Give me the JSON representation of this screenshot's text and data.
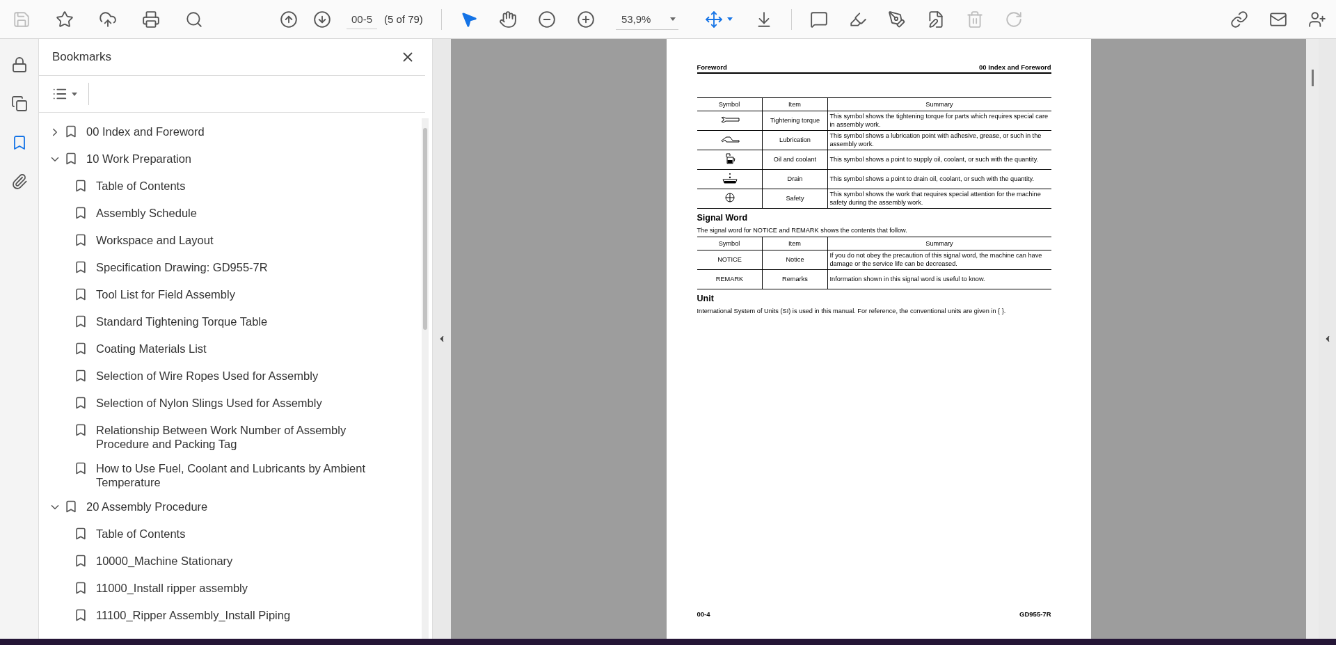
{
  "toolbar": {
    "file_tools": [
      {
        "kind": "save",
        "disabled": true
      },
      {
        "kind": "star",
        "disabled": false
      },
      {
        "kind": "upload",
        "disabled": false
      },
      {
        "kind": "print",
        "disabled": false
      },
      {
        "kind": "find",
        "disabled": false
      }
    ],
    "navigation": {
      "page_field": "00-5",
      "page_count": "(5 of 79)"
    },
    "view_tools": [
      {
        "kind": "pointer",
        "selected": true
      },
      {
        "kind": "hand",
        "selected": false
      },
      {
        "kind": "zoom_out",
        "selected": false
      },
      {
        "kind": "zoom_in",
        "selected": false
      }
    ],
    "zoom": {
      "value": "53,9%"
    },
    "edit_tools": [
      {
        "kind": "comment",
        "disabled": false
      },
      {
        "kind": "highlight",
        "disabled": false
      },
      {
        "kind": "sign",
        "disabled": false
      },
      {
        "kind": "edit",
        "disabled": false
      },
      {
        "kind": "delete",
        "disabled": true
      },
      {
        "kind": "redo",
        "disabled": true
      }
    ],
    "share_tools": [
      {
        "kind": "link"
      },
      {
        "kind": "mail"
      },
      {
        "kind": "add_user"
      }
    ]
  },
  "rail": [
    {
      "kind": "lock",
      "selected": false
    },
    {
      "kind": "pages",
      "selected": false
    },
    {
      "kind": "bookmarks",
      "selected": true
    },
    {
      "kind": "attachments",
      "selected": false
    }
  ],
  "bookmarks": {
    "title": "Bookmarks",
    "items": [
      {
        "label": "00 Index and Foreword",
        "expanded": false
      },
      {
        "label": "10 Work Preparation",
        "expanded": true,
        "children": [
          {
            "label": "Table of Contents"
          },
          {
            "label": "Assembly Schedule"
          },
          {
            "label": "Workspace and Layout"
          },
          {
            "label": "Specification Drawing: GD955-7R"
          },
          {
            "label": "Tool List for Field Assembly"
          },
          {
            "label": "Standard Tightening Torque Table"
          },
          {
            "label": "Coating Materials List"
          },
          {
            "label": "Selection of Wire Ropes Used for Assembly"
          },
          {
            "label": "Selection of Nylon Slings Used for Assembly"
          },
          {
            "label": "Relationship Between Work Number of Assembly Procedure and Packing Tag"
          },
          {
            "label": "How to Use Fuel, Coolant and Lubricants by Ambient Temperature"
          }
        ]
      },
      {
        "label": "20 Assembly Procedure",
        "expanded": true,
        "children": [
          {
            "label": "Table of Contents"
          },
          {
            "label": "10000_Machine Stationary"
          },
          {
            "label": "11000_Install ripper assembly"
          },
          {
            "label": "11100_Ripper Assembly_Install Piping"
          }
        ]
      }
    ]
  },
  "page": {
    "header_left": "Foreword",
    "header_right": "00 Index and Foreword",
    "symbol_table": {
      "columns": [
        "Symbol",
        "Item",
        "Summary"
      ],
      "rows": [
        {
          "kind": "wrench",
          "item": "Tightening torque",
          "summary": "This symbol shows the tightening torque for parts which requires special care in assembly work."
        },
        {
          "kind": "oil_can",
          "item": "Lubrication",
          "summary": "This symbol shows a lubrication point with adhesive, grease, or such in the assembly work."
        },
        {
          "kind": "jug",
          "item": "Oil and coolant",
          "summary": "This symbol shows a point to supply oil, coolant, or such with the quantity."
        },
        {
          "kind": "drain",
          "item": "Drain",
          "summary": "This symbol shows a point to drain oil, coolant, or such with the quantity."
        },
        {
          "kind": "crosshair",
          "item": "Safety",
          "summary": "This symbol shows the work that requires special attention for the machine safety during the assembly work."
        }
      ]
    },
    "signal_heading": "Signal Word",
    "signal_text": "The signal word for NOTICE and REMARK shows the contents that follow.",
    "signal_table": {
      "columns": [
        "Symbol",
        "Item",
        "Summary"
      ],
      "rows": [
        {
          "symbol": "NOTICE",
          "item": "Notice",
          "summary": "If you do not obey the precaution of this signal word, the machine can have damage or the service life can be decreased."
        },
        {
          "symbol": "REMARK",
          "item": "Remarks",
          "summary": "Information shown in this signal word is useful to know."
        }
      ]
    },
    "unit_heading": "Unit",
    "unit_text": "International System of Units (SI) is used in this manual. For reference, the conventional units are given in { }.",
    "footer_left": "00-4",
    "footer_right": "GD955-7R"
  }
}
